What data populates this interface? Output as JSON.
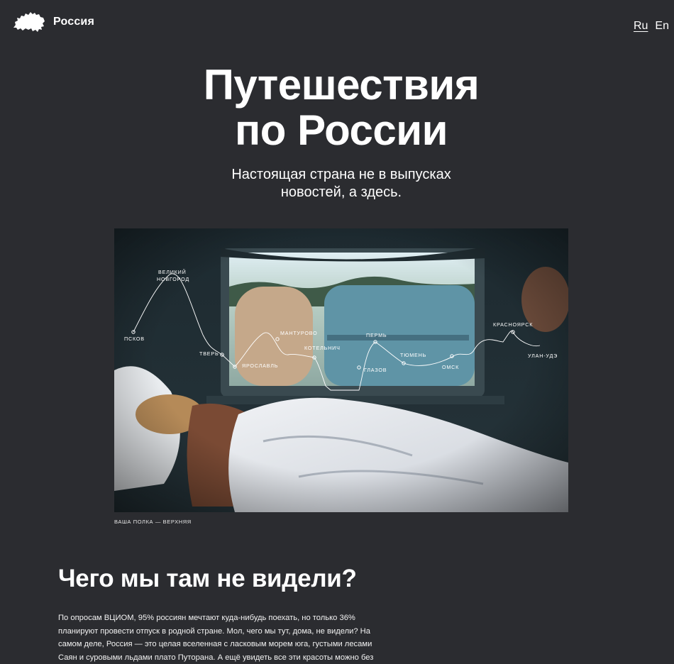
{
  "header": {
    "brand": "Россия",
    "languages": [
      {
        "label": "Ru",
        "active": true
      },
      {
        "label": "En",
        "active": false
      }
    ]
  },
  "hero": {
    "title_line1": "Путешествия",
    "title_line2": "по России",
    "subtitle_line1": "Настоящая страна не в выпусках",
    "subtitle_line2": "новостей, а здесь."
  },
  "photo": {
    "caption": "ваша полка — верхняя",
    "route_cities": [
      "Псков",
      "Великий Новгород",
      "Тверь",
      "Ярославль",
      "Мантурово",
      "Котельнич",
      "Глазов",
      "Пермь",
      "Тюмень",
      "Омск",
      "Красноярск",
      "Улан-Удэ"
    ]
  },
  "section": {
    "title": "Чего мы там не видели?",
    "body": "По опросам ВЦИОМ, 95% россиян мечтают куда-нибудь поехать, но только 36% планируют провести отпуск в родной стране. Мол, чего мы тут, дома, не видели? На самом деле, Россия — это целая вселенная с ласковым морем юга, густыми лесами Саян и суровыми льдами плато Путорана. А ещё увидеть все эти красоты можно без"
  },
  "colors": {
    "background": "#2b2c30",
    "text": "#ffffff"
  }
}
